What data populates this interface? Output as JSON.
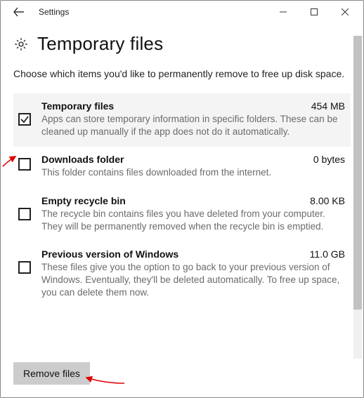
{
  "window": {
    "title": "Settings",
    "page_heading": "Temporary files"
  },
  "content": {
    "intro": "Choose which items you'd like to permanently remove to free up disk space.",
    "items": [
      {
        "title": "Temporary files",
        "size": "454 MB",
        "desc": "Apps can store temporary information in specific folders. These can be cleaned up manually if the app does not do it automatically.",
        "checked": true
      },
      {
        "title": "Downloads folder",
        "size": "0 bytes",
        "desc": "This folder contains files downloaded from the internet.",
        "checked": false
      },
      {
        "title": "Empty recycle bin",
        "size": "8.00 KB",
        "desc": "The recycle bin contains files you have deleted from your computer. They will be permanently removed when the recycle bin is emptied.",
        "checked": false
      },
      {
        "title": "Previous version of Windows",
        "size": "11.0 GB",
        "desc": "These files give you the option to go back to your previous version of Windows. Eventually, they'll be deleted automatically. To free up space, you can delete them now.",
        "checked": false
      }
    ],
    "remove_button": "Remove files"
  }
}
